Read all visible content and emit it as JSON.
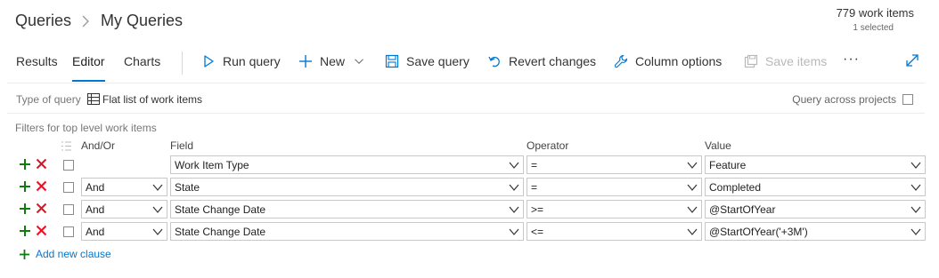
{
  "breadcrumb": {
    "root": "Queries",
    "current": "My Queries"
  },
  "summary": {
    "count": "779 work items",
    "selected": "1 selected"
  },
  "tabs": [
    "Results",
    "Editor",
    "Charts"
  ],
  "active_tab": "Editor",
  "toolbar": {
    "run_query": "Run query",
    "new": "New",
    "save_query": "Save query",
    "revert_changes": "Revert changes",
    "column_options": "Column options",
    "save_items": "Save items",
    "more": "···"
  },
  "query_type": {
    "label": "Type of query",
    "value": "Flat list of work items"
  },
  "query_across_projects": {
    "label": "Query across projects",
    "checked": false
  },
  "filters_label": "Filters for top level work items",
  "columns": {
    "andor": "And/Or",
    "field": "Field",
    "operator": "Operator",
    "value": "Value"
  },
  "clauses": [
    {
      "andor": "",
      "field": "Work Item Type",
      "operator": "=",
      "value": "Feature"
    },
    {
      "andor": "And",
      "field": "State",
      "operator": "=",
      "value": "Completed"
    },
    {
      "andor": "And",
      "field": "State Change Date",
      "operator": ">=",
      "value": "@StartOfYear"
    },
    {
      "andor": "And",
      "field": "State Change Date",
      "operator": "<=",
      "value": "@StartOfYear('+3M')"
    }
  ],
  "add_clause": "Add new clause",
  "colors": {
    "accent": "#0078d4",
    "add_green": "#107c10",
    "delete_red": "#e81123",
    "disabled": "#b8b8b8"
  }
}
